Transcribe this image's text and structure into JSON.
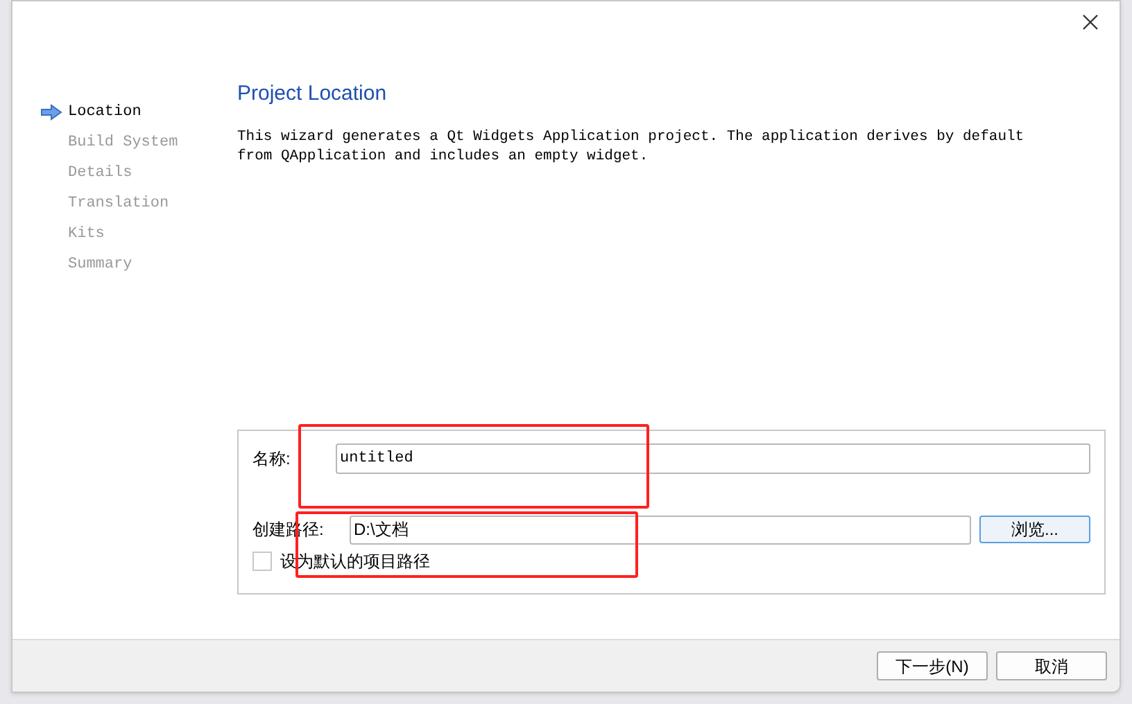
{
  "steps": [
    {
      "label": "Location",
      "selected": true
    },
    {
      "label": "Build System",
      "selected": false
    },
    {
      "label": "Details",
      "selected": false
    },
    {
      "label": "Translation",
      "selected": false
    },
    {
      "label": "Kits",
      "selected": false
    },
    {
      "label": "Summary",
      "selected": false
    }
  ],
  "title": "Project Location",
  "description": "This wizard generates a Qt Widgets Application project. The application derives by default from QApplication and includes an empty widget.",
  "name_field": {
    "label": "名称:",
    "value": "untitled"
  },
  "path_field": {
    "label": "创建路径:",
    "value": "D:\\文档",
    "button": "浏览..."
  },
  "default_path": {
    "label": "设为默认的项目路径",
    "checked": false
  },
  "buttons": [
    "下一步(N)",
    "取消"
  ]
}
